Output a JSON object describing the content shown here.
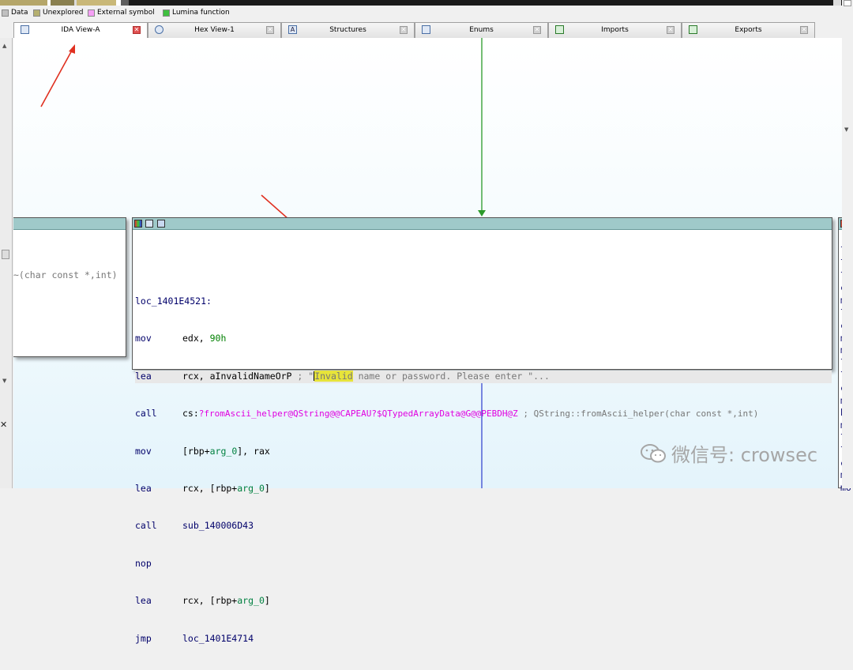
{
  "nav_band": {
    "colors": [
      "#b5a66a",
      "#ffffff",
      "#8a8050",
      "#dcdcdc",
      "#5d5d5d",
      "#c9b878"
    ]
  },
  "legend": {
    "items": [
      {
        "label": "Data",
        "color": "#c0c0c0"
      },
      {
        "label": "Unexplored",
        "color": "#b5b070"
      },
      {
        "label": "External symbol",
        "color": "#f5a0f5"
      },
      {
        "label": "Lumina function",
        "color": "#40c040"
      }
    ]
  },
  "tabs": [
    {
      "label": "IDA View-A",
      "icon": "ida-view-icon",
      "active": true
    },
    {
      "label": "Hex View-1",
      "icon": "hex-view-icon",
      "active": false
    },
    {
      "label": "Structures",
      "icon": "structures-icon",
      "active": false
    },
    {
      "label": "Enums",
      "icon": "enums-icon",
      "active": false
    },
    {
      "label": "Imports",
      "icon": "imports-icon",
      "active": false
    },
    {
      "label": "Exports",
      "icon": "exports-icon",
      "active": false
    }
  ],
  "left_node": {
    "partial_text": "~(char const *,int)"
  },
  "main_node": {
    "label": "loc_1401E4521:",
    "lines": [
      {
        "mnemonic": "mov",
        "op1": "edx, ",
        "num": "90h"
      },
      {
        "mnemonic": "lea",
        "op1": "rcx, aInvalidNameOrP",
        "comment_pre": " ; \"",
        "highlight": "Invalid",
        "comment_post": " name or password. Please enter \"..."
      },
      {
        "mnemonic": "call",
        "op1": "cs:",
        "symbol": "?fromAscii_helper@QString@@CAPEAU?$QTypedArrayData@G@@PEBDH@Z",
        "comment": " ; QString::fromAscii_helper(char const *,int)"
      },
      {
        "mnemonic": "mov",
        "op_a": "[rbp+",
        "var": "arg_0",
        "op_b": "], rax"
      },
      {
        "mnemonic": "lea",
        "op_a": "rcx, [rbp+",
        "var": "arg_0",
        "op_b": "]"
      },
      {
        "mnemonic": "call",
        "op1": "sub_140006D43"
      },
      {
        "mnemonic": "nop"
      },
      {
        "mnemonic": "lea",
        "op_a": "rcx, [rbp+",
        "var": "arg_0",
        "op_b": "]"
      },
      {
        "mnemonic": "jmp",
        "op1": "loc_1401E4714"
      }
    ]
  },
  "right_node": {
    "fragments": [
      "lo",
      "le",
      "le",
      "ca",
      "mo",
      "le",
      "ca",
      "mo",
      "mo",
      "le",
      "le",
      "ca",
      "mo",
      "bt",
      "mo",
      "le",
      "le",
      "ca",
      "mo",
      "mo"
    ]
  },
  "watermark": {
    "text": "微信号: crowsec"
  }
}
